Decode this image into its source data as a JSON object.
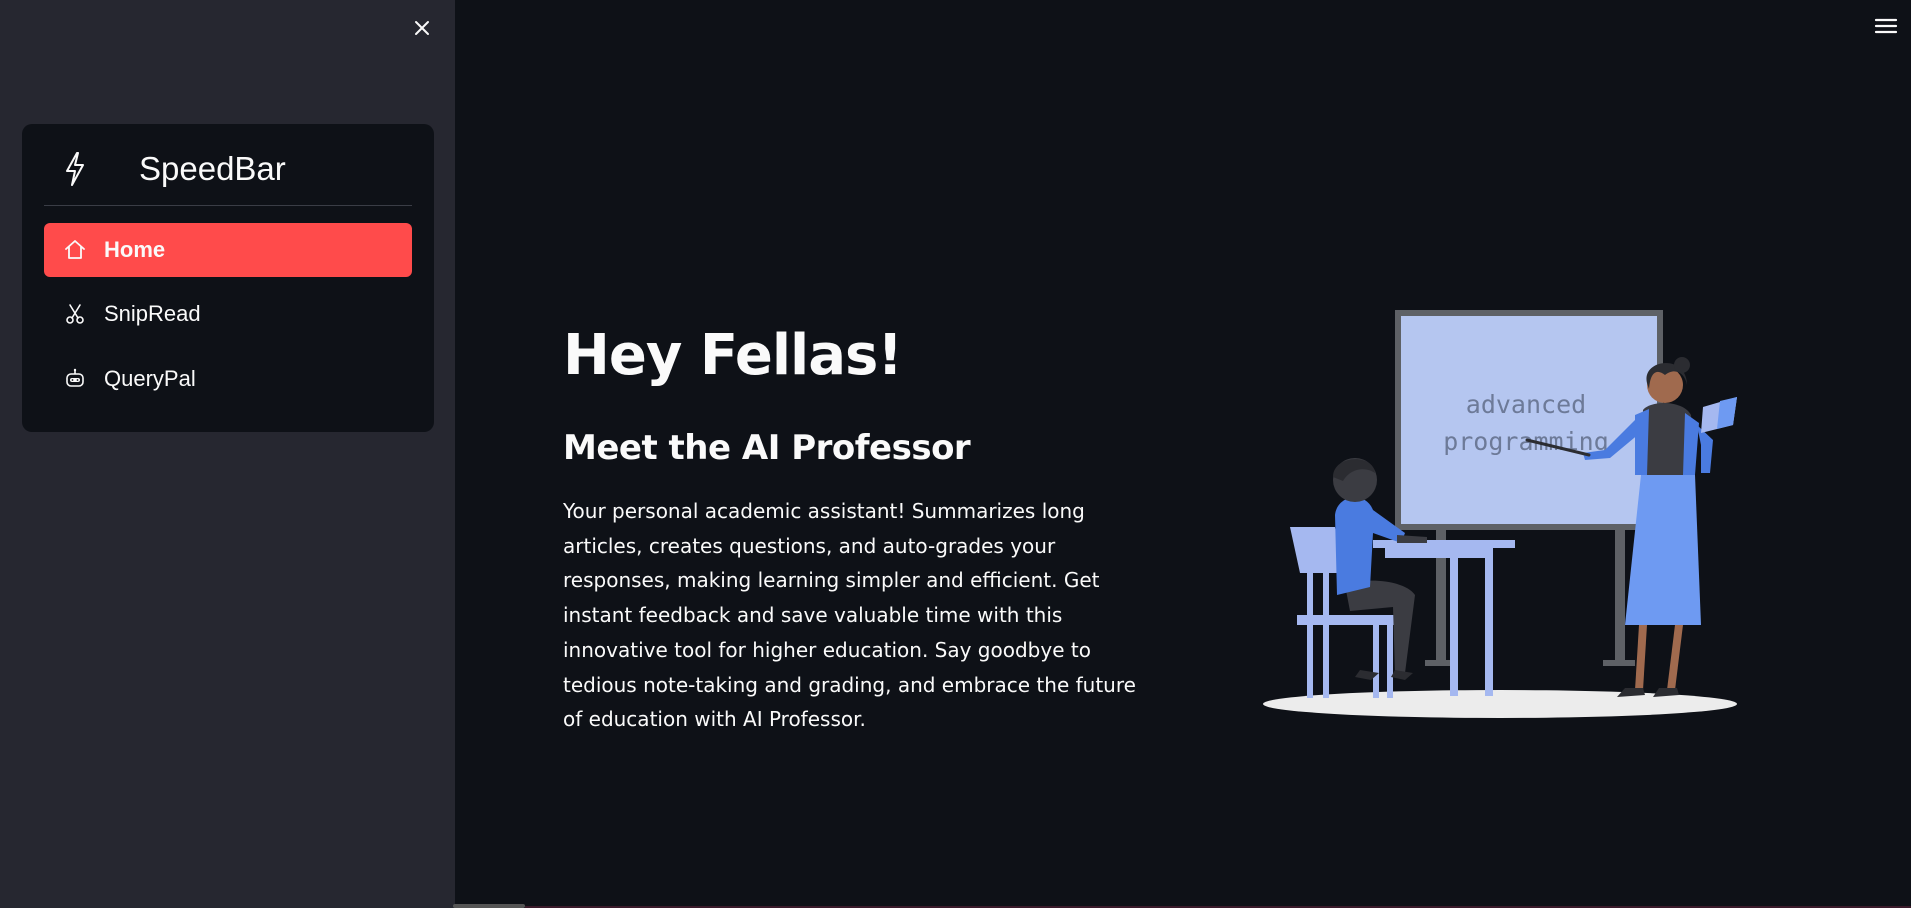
{
  "sidebar": {
    "close_label": "×",
    "menu": {
      "title": "SpeedBar",
      "title_icon": "bolt-icon",
      "items": [
        {
          "label": "Home",
          "icon": "house-icon",
          "active": true
        },
        {
          "label": "SnipRead",
          "icon": "scissors-icon",
          "active": false
        },
        {
          "label": "QueryPal",
          "icon": "robot-icon",
          "active": false
        }
      ]
    }
  },
  "header": {
    "menu_icon": "hamburger-icon"
  },
  "main": {
    "title": "Hey Fellas!",
    "subtitle": "Meet the AI Professor",
    "description": "Your personal academic assistant! Summarizes long articles, creates questions, and auto-grades your responses, making learning simpler and efficient. Get instant feedback and save valuable time with this innovative tool for higher education. Say goodbye to tedious note-taking and grading, and embrace the future of education with AI Professor.",
    "illustration": {
      "board_line1": "advanced",
      "board_line2": "programming"
    }
  },
  "colors": {
    "accent": "#ff4b4b",
    "background": "#0e1117",
    "sidebar": "#262730",
    "illustration_blue": "#5b86e5"
  }
}
